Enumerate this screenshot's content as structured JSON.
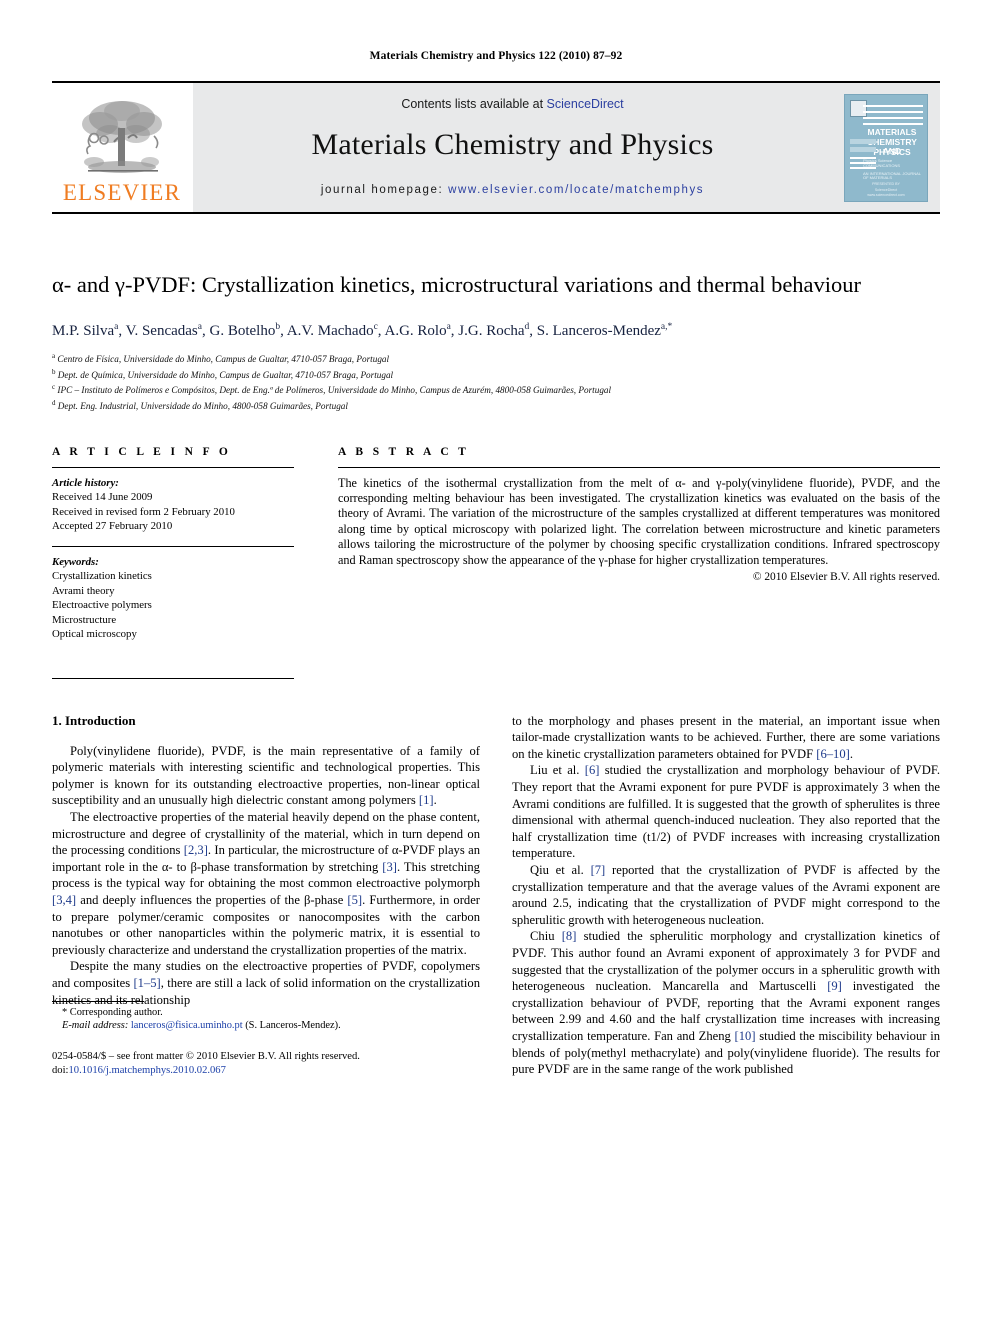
{
  "running_head": "Materials Chemistry and Physics 122 (2010) 87–92",
  "masthead": {
    "publisher_name": "ELSEVIER",
    "contents_prefix": "Contents lists available at ",
    "contents_link": "ScienceDirect",
    "journal_title": "Materials Chemistry and Physics",
    "homepage_prefix": "journal homepage: ",
    "homepage_url": "www.elsevier.com/locate/matchemphys",
    "cover": {
      "title_line1": "MATERIALS",
      "title_line2": "CHEMISTRY AND",
      "title_line3": "PHYSICS",
      "sub_line1": "Physics Science",
      "sub_line2": "COMMUNICATIONS",
      "sub_line3": "AN INTERNATIONAL JOURNAL OF MATERIALS",
      "footer_line1": "PRESENTED BY",
      "footer_line2": "ScienceDirect",
      "footer_line3": "www.sciencedirect.com"
    }
  },
  "article": {
    "title": "α- and γ-PVDF: Crystallization kinetics, microstructural variations and thermal behaviour",
    "authors": [
      {
        "name": "M.P. Silva",
        "marks": "a"
      },
      {
        "name": "V. Sencadas",
        "marks": "a"
      },
      {
        "name": "G. Botelho",
        "marks": "b"
      },
      {
        "name": "A.V. Machado",
        "marks": "c"
      },
      {
        "name": "A.G. Rolo",
        "marks": "a"
      },
      {
        "name": "J.G. Rocha",
        "marks": "d"
      },
      {
        "name": "S. Lanceros-Mendez",
        "marks": "a,*"
      }
    ],
    "affiliations": [
      {
        "mark": "a",
        "text": "Centro de Física, Universidade do Minho, Campus de Gualtar, 4710-057 Braga, Portugal"
      },
      {
        "mark": "b",
        "text": "Dept. de Química, Universidade do Minho, Campus de Gualtar, 4710-057 Braga, Portugal"
      },
      {
        "mark": "c",
        "text": "IPC – Instituto de Polímeros e Compósitos, Dept. de Eng.ª de Polímeros, Universidade do Minho, Campus de Azurém, 4800-058 Guimarães, Portugal"
      },
      {
        "mark": "d",
        "text": "Dept. Eng. Industrial, Universidade do Minho, 4800-058 Guimarães, Portugal"
      }
    ]
  },
  "article_info": {
    "heading": "A R T I C L E   I N F O",
    "history_label": "Article history:",
    "history": [
      "Received 14 June 2009",
      "Received in revised form 2 February 2010",
      "Accepted 27 February 2010"
    ],
    "keywords_label": "Keywords:",
    "keywords": [
      "Crystallization kinetics",
      "Avrami theory",
      "Electroactive polymers",
      "Microstructure",
      "Optical microscopy"
    ]
  },
  "abstract": {
    "heading": "A B S T R A C T",
    "text": "The kinetics of the isothermal crystallization from the melt of α- and γ-poly(vinylidene fluoride), PVDF, and the corresponding melting behaviour has been investigated. The crystallization kinetics was evaluated on the basis of the theory of Avrami. The variation of the microstructure of the samples crystallized at different temperatures was monitored along time by optical microscopy with polarized light. The correlation between microstructure and kinetic parameters allows tailoring the microstructure of the polymer by choosing specific crystallization conditions. Infrared spectroscopy and Raman spectroscopy show the appearance of the γ-phase for higher crystallization temperatures.",
    "copyright": "© 2010 Elsevier B.V. All rights reserved."
  },
  "body": {
    "section_number_title": "1.  Introduction",
    "left_paragraphs": [
      "Poly(vinylidene fluoride), PVDF, is the main representative of a family of polymeric materials with interesting scientific and technological properties. This polymer is known for its outstanding electroactive properties, non-linear optical susceptibility and an unusually high dielectric constant among polymers [1].",
      "The electroactive properties of the material heavily depend on the phase content, microstructure and degree of crystallinity of the material, which in turn depend on the processing conditions [2,3]. In particular, the microstructure of α-PVDF plays an important role in the α- to β-phase transformation by stretching [3]. This stretching process is the typical way for obtaining the most common electroactive polymorph [3,4] and deeply influences the properties of the β-phase [5]. Furthermore, in order to prepare polymer/ceramic composites or nanocomposites with the carbon nanotubes or other nanoparticles within the polymeric matrix, it is essential to previously characterize and understand the crystallization properties of the matrix.",
      "Despite the many studies on the electroactive properties of PVDF, copolymers and composites [1–5], there are still a lack of solid information on the crystallization kinetics and its relationship"
    ],
    "right_paragraphs": [
      "to the morphology and phases present in the material, an important issue when tailor-made crystallization wants to be achieved. Further, there are some variations on the kinetic crystallization parameters obtained for PVDF [6–10].",
      "Liu et al. [6] studied the crystallization and morphology behaviour of PVDF. They report that the Avrami exponent for pure PVDF is approximately 3 when the Avrami conditions are fulfilled. It is suggested that the growth of spherulites is three dimensional with athermal quench-induced nucleation. They also reported that the half crystallization time (t1/2) of PVDF increases with increasing crystallization temperature.",
      "Qiu et al. [7] reported that the crystallization of PVDF is affected by the crystallization temperature and that the average values of the Avrami exponent are around 2.5, indicating that the crystallization of PVDF might correspond to the spherulitic growth with heterogeneous nucleation.",
      "Chiu [8] studied the spherulitic morphology and crystallization kinetics of PVDF. This author found an Avrami exponent of approximately 3 for PVDF and suggested that the crystallization of the polymer occurs in a spherulitic growth with heterogeneous nucleation. Mancarella and Martuscelli [9] investigated the crystallization behaviour of PVDF, reporting that the Avrami exponent ranges between 2.99 and 4.60 and the half crystallization time increases with increasing crystallization temperature. Fan and Zheng [10] studied the miscibility behaviour in blends of poly(methyl methacrylate) and poly(vinylidene fluoride). The results for pure PVDF are in the same range of the work published"
    ]
  },
  "footnote": {
    "corresponding_author": "* Corresponding author.",
    "email_label": "E-mail address:",
    "email": "lanceros@fisica.uminho.pt",
    "email_suffix": "(S. Lanceros-Mendez).",
    "imprint_line": "0254-0584/$ – see front matter © 2010 Elsevier B.V. All rights reserved.",
    "doi_label": "doi:",
    "doi_value": "10.1016/j.matchemphys.2010.02.067"
  },
  "colors": {
    "elsevier_orange": "#ef7c22",
    "link_blue": "#2b3fa0",
    "reference_blue": "#1e3a8a",
    "masthead_gray": "#e8e9ea",
    "cover_blue": "#8fb9cc"
  }
}
